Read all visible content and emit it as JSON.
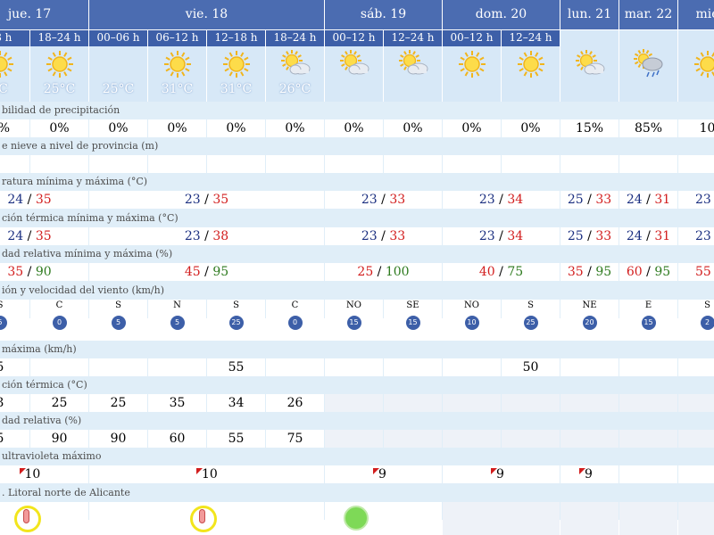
{
  "days": [
    {
      "label": "jue. 17"
    },
    {
      "label": "vie. 18"
    },
    {
      "label": "sáb. 19"
    },
    {
      "label": "dom. 20"
    },
    {
      "label": "lun. 21"
    },
    {
      "label": "mar. 22"
    },
    {
      "label": "mié"
    }
  ],
  "periods": [
    {
      "label": "18 h",
      "icon": "sun-icon",
      "temp": "°C"
    },
    {
      "label": "18–24 h",
      "icon": "sun-icon",
      "temp": "25°C"
    },
    {
      "label": "00–06 h",
      "icon": "moon-icon",
      "temp": "25°C"
    },
    {
      "label": "06–12 h",
      "icon": "sun-icon",
      "temp": "31°C"
    },
    {
      "label": "12–18 h",
      "icon": "sun-icon",
      "temp": "31°C"
    },
    {
      "label": "18–24 h",
      "icon": "sun-cloud-icon",
      "temp": "26°C"
    },
    {
      "label": "00–12 h",
      "icon": "sun-cloud-icon",
      "temp": ""
    },
    {
      "label": "12–24 h",
      "icon": "sun-cloud-icon",
      "temp": ""
    },
    {
      "label": "00–12 h",
      "icon": "sun-icon",
      "temp": ""
    },
    {
      "label": "12–24 h",
      "icon": "sun-icon",
      "temp": ""
    },
    {
      "label": "",
      "icon": "sun-cloud-icon",
      "temp": ""
    },
    {
      "label": "",
      "icon": "rain-cloud-icon",
      "temp": ""
    },
    {
      "label": "",
      "icon": "sun-icon",
      "temp": ""
    }
  ],
  "rows": {
    "precip": {
      "label": "bilidad de precipitación",
      "values": [
        "0%",
        "0%",
        "0%",
        "0%",
        "0%",
        "0%",
        "0%",
        "0%",
        "0%",
        "0%",
        "15%",
        "85%",
        "10"
      ]
    },
    "snow": {
      "label": "e nieve a nivel de provincia (m)"
    },
    "temp": {
      "label": "ratura mínima y máxima (°C)"
    },
    "feels": {
      "label": "ción térmica mínima y máxima (°C)"
    },
    "humidity": {
      "label": "dad relativa mínima y máxima (%)"
    },
    "wind": {
      "label": "ión y velocidad del viento (km/h)"
    },
    "gust": {
      "label": " máxima (km/h)",
      "values": [
        "5",
        "",
        "",
        "",
        "55",
        "",
        "",
        "",
        "",
        "50",
        "",
        "",
        ""
      ]
    },
    "feelsHour": {
      "label": "ción térmica (°C)",
      "values": [
        "3",
        "25",
        "25",
        "35",
        "34",
        "26"
      ]
    },
    "humHour": {
      "label": "dad relativa (%)",
      "values": [
        "5",
        "90",
        "90",
        "60",
        "55",
        "75"
      ]
    },
    "uv": {
      "label": "ultravioleta máximo"
    },
    "warning": {
      "label": ". Litoral norte de Alicante"
    }
  },
  "temp_minmax": [
    {
      "lo": "24",
      "sep": " / ",
      "hi": "35"
    },
    {
      "lo": "23",
      "sep": " / ",
      "hi": "35"
    },
    {
      "lo": "23",
      "sep": " / ",
      "hi": "33"
    },
    {
      "lo": "23",
      "sep": " / ",
      "hi": "34"
    },
    {
      "lo": "25",
      "sep": " / ",
      "hi": "33"
    },
    {
      "lo": "24",
      "sep": " / ",
      "hi": "31"
    },
    {
      "lo": "23",
      "sep": " / ",
      "hi": ""
    }
  ],
  "feels_minmax": [
    {
      "lo": "24",
      "sep": " / ",
      "hi": "35"
    },
    {
      "lo": "23",
      "sep": " / ",
      "hi": "38"
    },
    {
      "lo": "23",
      "sep": " / ",
      "hi": "33"
    },
    {
      "lo": "23",
      "sep": " / ",
      "hi": "34"
    },
    {
      "lo": "25",
      "sep": " / ",
      "hi": "33"
    },
    {
      "lo": "24",
      "sep": " / ",
      "hi": "31"
    },
    {
      "lo": "23",
      "sep": " / ",
      "hi": ""
    }
  ],
  "humidity_minmax": [
    {
      "lo": "35",
      "sep": " / ",
      "hi": "90"
    },
    {
      "lo": "45",
      "sep": " / ",
      "hi": "95"
    },
    {
      "lo": "25",
      "sep": " / ",
      "hi": "100"
    },
    {
      "lo": "40",
      "sep": " / ",
      "hi": "75"
    },
    {
      "lo": "35",
      "sep": " / ",
      "hi": "95"
    },
    {
      "lo": "60",
      "sep": " / ",
      "hi": "95"
    },
    {
      "lo": "55",
      "sep": " / ",
      "hi": ""
    }
  ],
  "wind": [
    {
      "dir": "S",
      "speed": "5"
    },
    {
      "dir": "C",
      "speed": "0"
    },
    {
      "dir": "S",
      "speed": "5"
    },
    {
      "dir": "N",
      "speed": "5"
    },
    {
      "dir": "S",
      "speed": "25"
    },
    {
      "dir": "C",
      "speed": "0"
    },
    {
      "dir": "NO",
      "speed": "15"
    },
    {
      "dir": "SE",
      "speed": "15"
    },
    {
      "dir": "NO",
      "speed": "10"
    },
    {
      "dir": "S",
      "speed": "25"
    },
    {
      "dir": "NE",
      "speed": "20"
    },
    {
      "dir": "E",
      "speed": "15"
    },
    {
      "dir": "S",
      "speed": "2"
    }
  ],
  "uv": [
    {
      "value": "10"
    },
    {
      "value": "10"
    },
    {
      "value": "9"
    },
    {
      "value": "9"
    },
    {
      "value": "9"
    }
  ],
  "colors": {
    "header": "#4b6cb1",
    "subheader": "#3d5fa8",
    "label_band": "#e0eef8",
    "min": "#1b2f80",
    "max": "#d21d1d",
    "warning_yellow": "#f2e51c",
    "warning_green": "#7ed957"
  }
}
